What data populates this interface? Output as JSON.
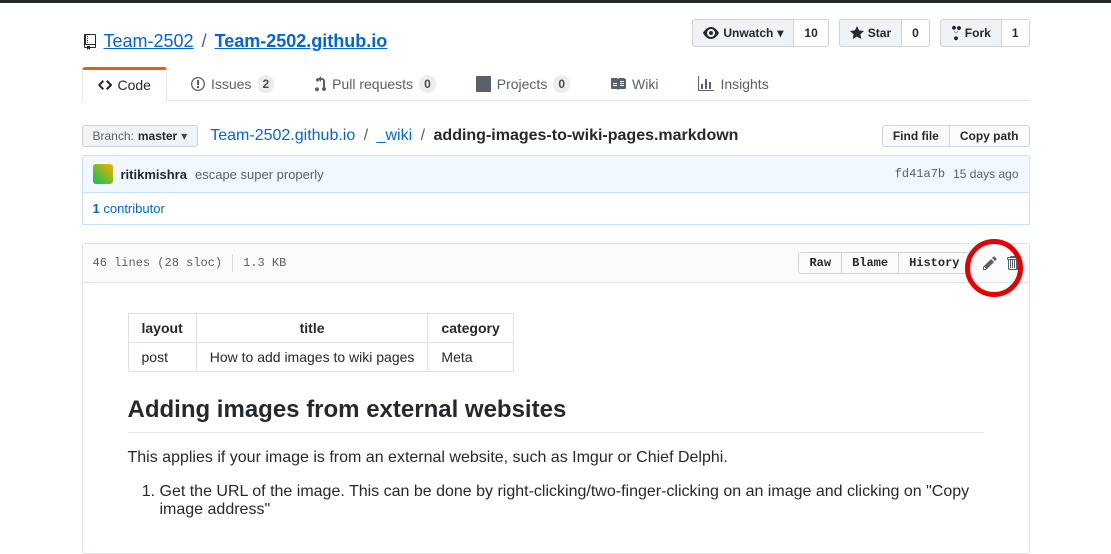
{
  "repo": {
    "owner": "Team-2502",
    "name": "Team-2502.github.io"
  },
  "actions": {
    "unwatch": "Unwatch",
    "unwatch_count": "10",
    "star": "Star",
    "star_count": "0",
    "fork": "Fork",
    "fork_count": "1"
  },
  "tabs": {
    "code": "Code",
    "issues": "Issues",
    "issues_count": "2",
    "pull_requests": "Pull requests",
    "pr_count": "0",
    "projects": "Projects",
    "projects_count": "0",
    "wiki": "Wiki",
    "insights": "Insights"
  },
  "branch": {
    "label": "Branch:",
    "name": "master"
  },
  "breadcrumb": {
    "root": "Team-2502.github.io",
    "dir": "_wiki",
    "file": "adding-images-to-wiki-pages.markdown"
  },
  "file_buttons": {
    "find": "Find file",
    "copy": "Copy path",
    "raw": "Raw",
    "blame": "Blame",
    "history": "History"
  },
  "commit": {
    "author": "ritikmishra",
    "message": "escape super properly",
    "sha": "fd41a7b",
    "time": "15 days ago"
  },
  "contributors": {
    "count": "1",
    "label": "contributor"
  },
  "file_meta": {
    "lines": "46 lines (28 sloc)",
    "size": "1.3 KB"
  },
  "frontmatter": {
    "h_layout": "layout",
    "h_title": "title",
    "h_category": "category",
    "layout": "post",
    "title": "How to add images to wiki pages",
    "category": "Meta"
  },
  "content": {
    "heading": "Adding images from external websites",
    "paragraph": "This applies if your image is from an external website, such as Imgur or Chief Delphi.",
    "step1": "Get the URL of the image. This can be done by right-clicking/two-finger-clicking on an image and clicking on \"Copy image address\""
  }
}
